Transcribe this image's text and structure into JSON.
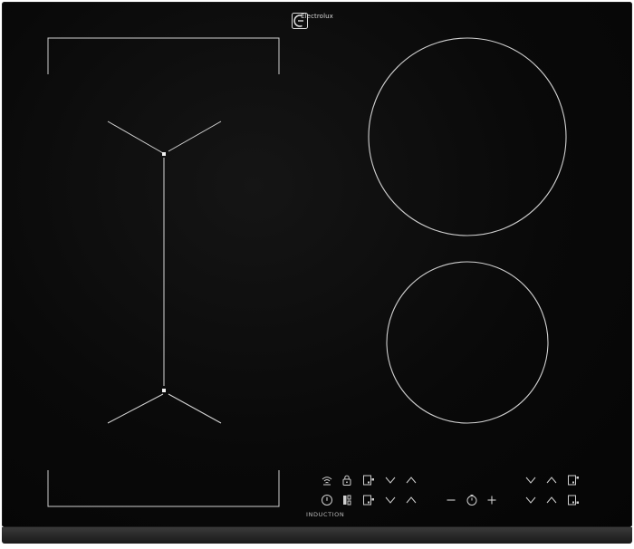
{
  "brand": {
    "name": "Electrolux",
    "logo_icon": "electrolux-logo-icon"
  },
  "control_panel": {
    "technology_label": "INDUCTION",
    "left_row_top": [
      "wifi-icon",
      "lock-icon",
      "bridge-zone-icon",
      "chevron-down-icon",
      "chevron-up-icon"
    ],
    "left_row_bottom": [
      "power-icon",
      "pause-icon",
      "bridge-zone-icon",
      "chevron-down-icon",
      "chevron-up-icon"
    ],
    "timer": [
      "minus-icon",
      "timer-icon",
      "plus-icon"
    ],
    "right_row_top": [
      "chevron-down-icon",
      "chevron-up-icon",
      "zone-select-icon"
    ],
    "right_row_bottom": [
      "chevron-down-icon",
      "chevron-up-icon",
      "zone-select-icon"
    ]
  },
  "colors": {
    "surface": "#0a0a0a",
    "graphics": "#d0d0d0"
  }
}
